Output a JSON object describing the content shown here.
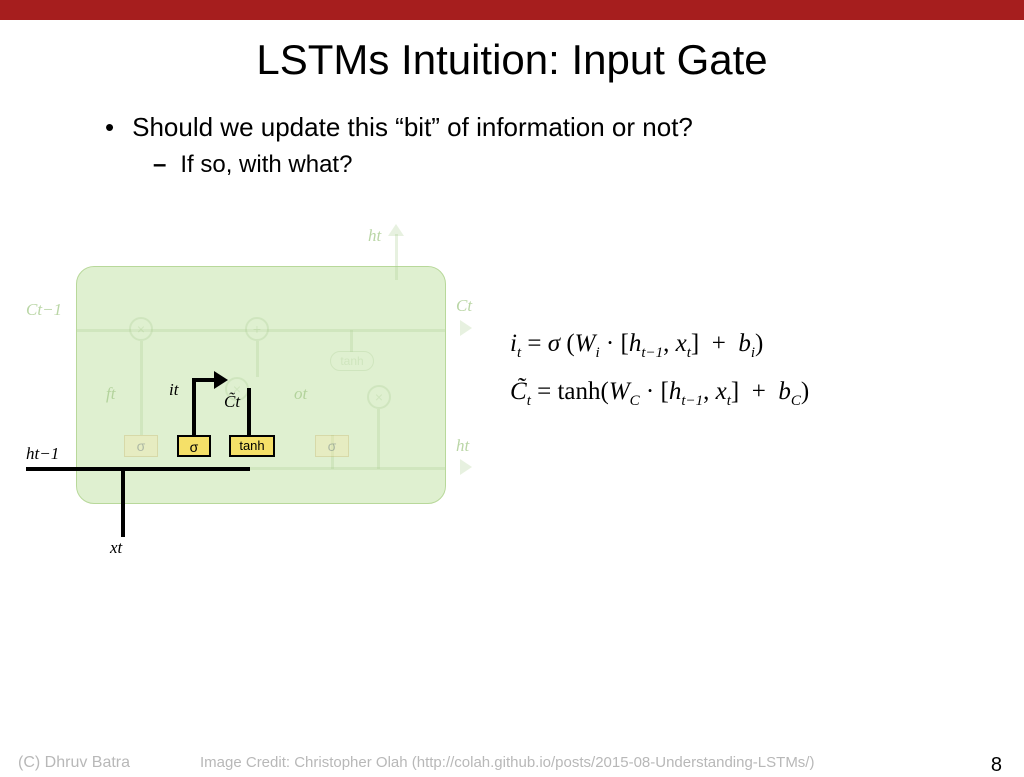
{
  "title": "LSTMs Intuition: Input Gate",
  "bullet_main": "Should we update this “bit” of information or not?",
  "bullet_sub": "If so, with what?",
  "diagram_labels": {
    "Ct_minus_1": "C",
    "Ct_minus_1_sub": "t−1",
    "Ct": "C",
    "Ct_sub": "t",
    "ht_top": "h",
    "ht_top_sub": "t",
    "ht_right": "h",
    "ht_right_sub": "t",
    "h_t_minus_1": "h",
    "h_t_minus_1_sub": "t−1",
    "x_t": "x",
    "x_t_sub": "t",
    "f_t": "f",
    "f_t_sub": "t",
    "i_t": "i",
    "i_t_sub": "t",
    "C_tilde": "C̃",
    "C_tilde_sub": "t",
    "o_t": "o",
    "o_t_sub": "t",
    "sigma": "σ",
    "tanh": "tanh"
  },
  "equations": {
    "line1": "i_t = σ ( W_i · [h_{t−1}, x_t]  +  b_i )",
    "line2": "C̃_t = tanh( W_C · [h_{t−1}, x_t]  +  b_C )"
  },
  "footer": {
    "copyright": "(C) Dhruv Batra",
    "credit": "Image Credit: Christopher Olah (http://colah.github.io/posts/2015-08-Understanding-LSTMs/)",
    "page": "8"
  },
  "colors": {
    "accent_bar": "#a61e1e",
    "cell_bg": "#dff0d0",
    "faded_green": "#a9cc90",
    "gate_yellow": "#f5e068"
  }
}
